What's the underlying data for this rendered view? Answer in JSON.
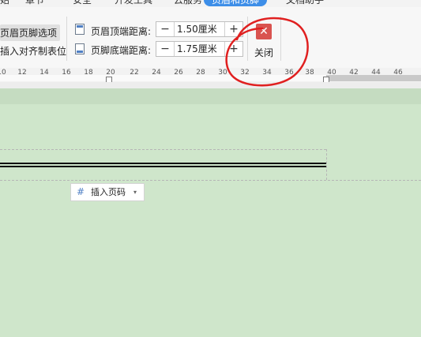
{
  "tabs": [
    {
      "label": "始"
    },
    {
      "label": "章节"
    },
    {
      "label": "安全"
    },
    {
      "label": "开发工具"
    },
    {
      "label": "云服务"
    },
    {
      "label": "页眉和页脚"
    },
    {
      "label": "文档助手"
    }
  ],
  "toolbar": {
    "header_footer_options": "页眉页脚选项",
    "insert_align_tab": "插入对齐制表位",
    "header_top_label": "页眉顶端距离:",
    "header_top_value": "1.50厘米",
    "footer_bottom_label": "页脚底端距离:",
    "footer_bottom_value": "1.75厘米",
    "minus": "−",
    "plus": "+",
    "close_label": "关闭",
    "close_glyph": "✕"
  },
  "ruler": {
    "ticks": [
      "10",
      "12",
      "14",
      "16",
      "18",
      "20",
      "22",
      "24",
      "26",
      "28",
      "30",
      "32",
      "34",
      "36",
      "38",
      "40",
      "42",
      "44",
      "46"
    ]
  },
  "document": {
    "insert_page_number": "插入页码",
    "page_number_icon": "#",
    "caret": "▾"
  },
  "colors": {
    "accent_tab": "#3d8ee8",
    "close_red": "#d9534f",
    "annotation_red": "#e02020",
    "canvas_green": "#cfe6cb"
  }
}
